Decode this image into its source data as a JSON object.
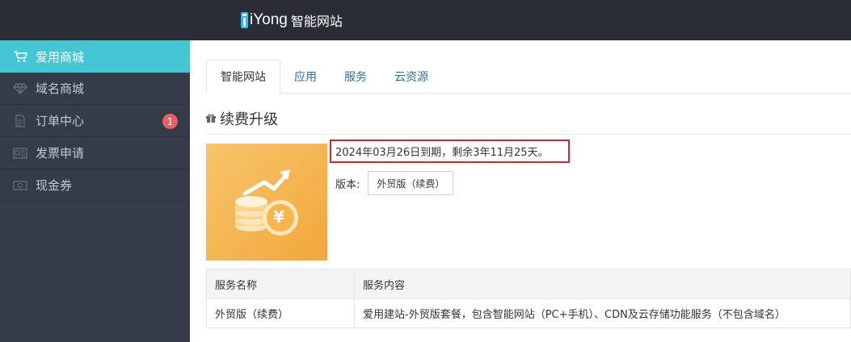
{
  "header": {
    "logo_brand": "iYong",
    "logo_sub": "智能网站"
  },
  "sidebar": {
    "items": [
      {
        "label": "爱用商城",
        "icon": "cart-icon",
        "active": true
      },
      {
        "label": "域名商城",
        "icon": "diamond-icon"
      },
      {
        "label": "订单中心",
        "icon": "document-icon",
        "badge": "1"
      },
      {
        "label": "发票申请",
        "icon": "invoice-icon"
      },
      {
        "label": "现金券",
        "icon": "coupon-icon"
      }
    ]
  },
  "tabs": [
    {
      "label": "智能网站",
      "active": true
    },
    {
      "label": "应用"
    },
    {
      "label": "服务"
    },
    {
      "label": "云资源"
    }
  ],
  "section": {
    "title": "续费升级",
    "icon": "gift-icon"
  },
  "product": {
    "image_icon": "coins-growth-icon",
    "coin_symbol": "¥",
    "expire_text": "2024年03月26日到期，剩余3年11月25天。",
    "version_label": "版本:",
    "version_value": "外贸版（续费）"
  },
  "table": {
    "headers": [
      "服务名称",
      "服务内容"
    ],
    "rows": [
      [
        "外贸版（续费）",
        "爱用建站-外贸版套餐，包含智能网站（PC+手机）、CDN及云存储功能服务（不包含域名）"
      ]
    ]
  },
  "colors": {
    "topbar": "#2b2d36",
    "sidebar": "#353b48",
    "accent": "#45c6d4",
    "badge": "#ee5c63",
    "highlight_border": "#d0262d"
  }
}
